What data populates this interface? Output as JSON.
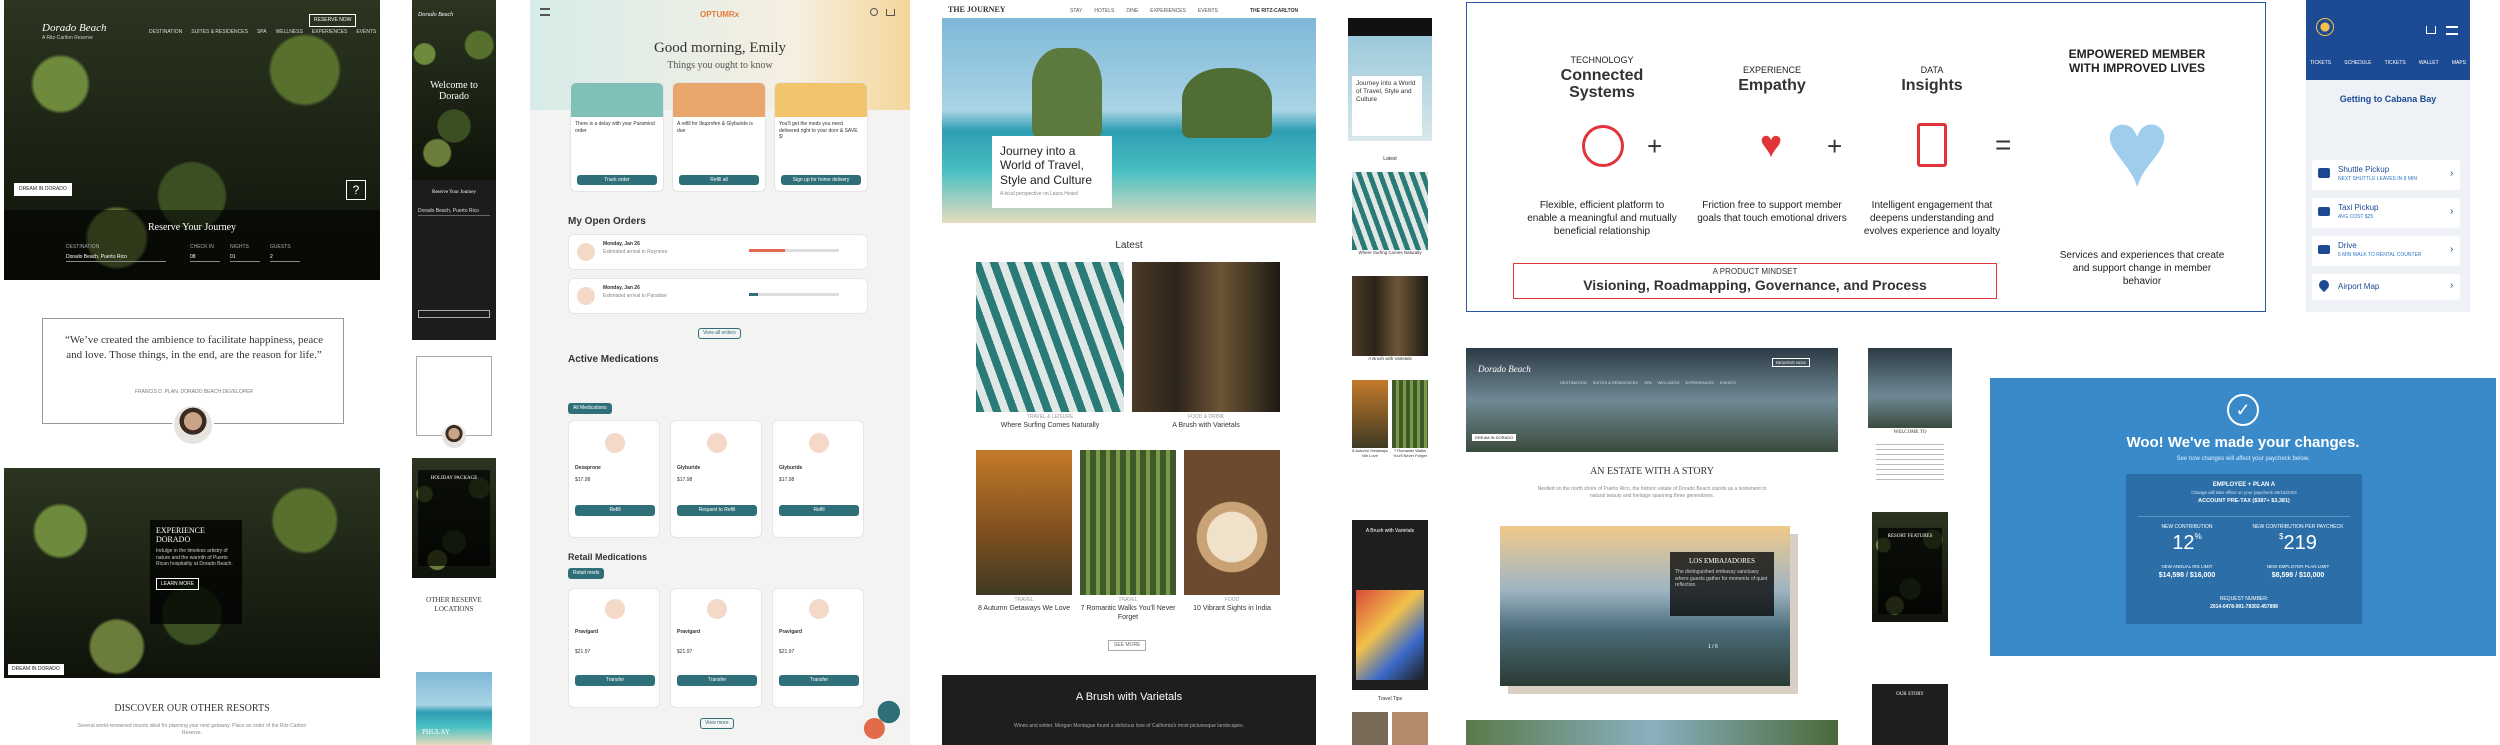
{
  "dorado": {
    "logo": "Dorado Beach",
    "logo_sub": "A Ritz-Carlton Reserve",
    "nav": [
      "DESTINATION",
      "SUITES & RESIDENCES",
      "SPA",
      "WELLNESS",
      "EXPERIENCES",
      "EVENTS"
    ],
    "top_button": "RESERVE NOW",
    "hero_badge": "DREAM IN DORADO",
    "reserve_title": "Reserve Your Journey",
    "destination_label": "DESTINATION",
    "destination_value": "Dorado Beach, Puerto Rico",
    "checkin_label": "CHECK IN",
    "checkin_value": "08",
    "checkout_label": "NIGHTS",
    "checkout_value": "01",
    "guests_label": "GUESTS",
    "guests_value": "2",
    "quote": "“We’ve created the ambience to facilitate happiness, peace and love. Those things, in the end, are the reason for life.”",
    "quote_author": "FRANCIS D. PLAN, DORADO BEACH DEVELOPER",
    "experience_title": "EXPERIENCE DORADO",
    "experience_text": "Indulge in the timeless artistry of nature and the warmth of Puerto Rican hospitality at Dorado Beach.",
    "experience_button": "LEARN MORE",
    "discover_title": "DISCOVER OUR OTHER RESORTS",
    "discover_text": "Several world-renowned resorts ideal for planning your next getaway. Place an order of the Ritz-Carlton Reserve."
  },
  "dorado_mobile": {
    "welcome": "Welcome to Dorado",
    "reserve_title": "Reserve Your Journey",
    "destination": "Dorado Beach, Puerto Rico",
    "holiday": "HOLIDAY PACKAGE",
    "other": "OTHER RESERVE LOCATIONS",
    "phulay": "PHULAY"
  },
  "health": {
    "brand": "OPTUMRx",
    "greeting": "Good morning, Emily",
    "subgreeting": "Things you ought to know",
    "tips": [
      {
        "title": "There is a delay with your Paramind order",
        "btn": "Track order"
      },
      {
        "title": "A refill for Ibuprofen & Glyburide is due",
        "btn": "Refill all"
      },
      {
        "title": "You'll get the meds you need delivered right to your door & SAVE $!",
        "btn": "Sign up for home delivery"
      }
    ],
    "orders_title": "My Open Orders",
    "orders": [
      {
        "date": "Monday, Jan 26",
        "desc": "Estimated arrival to Raymore"
      },
      {
        "date": "Monday, Jan 26",
        "desc": "Estimated arrival to Paradise"
      }
    ],
    "view_all": "View all orders",
    "active_title": "Active Medications",
    "filter_label": "All Medications",
    "meds": [
      {
        "name": "Dexaprone",
        "price": "$17.98",
        "action": "Refill"
      },
      {
        "name": "Glyburide",
        "price": "$17.98",
        "action": "Request to Refill"
      },
      {
        "name": "Glyburide",
        "price": "$17.98",
        "action": "Refill"
      }
    ],
    "retail_title": "Retail Medications",
    "retail_filter": "Retail meds",
    "retail": [
      {
        "name": "Pravigard",
        "price": "$21.97",
        "action": "Transfer"
      },
      {
        "name": "Pravigard",
        "price": "$21.97",
        "action": "Transfer"
      },
      {
        "name": "Pravigard",
        "price": "$21.97",
        "action": "Transfer"
      }
    ],
    "view_more": "View more"
  },
  "journey": {
    "logo": "THE JOURNEY",
    "nav": [
      "STAY",
      "HOTELS",
      "DINE",
      "EXPERIENCES",
      "EVENTS"
    ],
    "brand_right": "THE RITZ-CARLTON",
    "hero_title": "Journey into a World of Travel, Style and Culture",
    "hero_meta": "A local perspective on Laura Heard",
    "latest": "Latest",
    "articles": [
      {
        "cat": "TRAVEL & LEISURE",
        "title": "Where Surfing Comes Naturally"
      },
      {
        "cat": "FOOD & DRINK",
        "title": "A Brush with Varietals"
      },
      {
        "cat": "TRAVEL",
        "title": "8 Autumn Getaways We Love"
      },
      {
        "cat": "TRAVEL",
        "title": "7 Romantic Walks You'll Never Forget"
      },
      {
        "cat": "FOOD",
        "title": "10 Vibrant Sights in India"
      }
    ],
    "load_more": "SEE MORE",
    "feature_title": "A Brush with Varietals",
    "feature_text": "Wines and winter. Morgan Montague found a delicious love of California's most picturesque landscapes."
  },
  "journey_mobile": {
    "title": "Journey into a World of Travel, Style and Culture",
    "latest": "Latest",
    "items": [
      "Where Surfing Comes Naturally",
      "A Brush with Varietals",
      "8 Autumn Getaways We Love",
      "7 Romantic Walks You'll Never Forget"
    ],
    "feature": "A Brush with Varietals",
    "travel_tips": "Travel Tips"
  },
  "member": {
    "cols": [
      {
        "kicker": "TECHNOLOGY",
        "title": "Connected Systems",
        "text": "Flexible, efficient platform to enable a meaningful and mutually beneficial relationship"
      },
      {
        "kicker": "EXPERIENCE",
        "title": "Empathy",
        "text": "Friction free to support member goals that touch emotional drivers"
      },
      {
        "kicker": "DATA",
        "title": "Insights",
        "text": "Intelligent engagement that deepens understanding and evolves experience and loyalty"
      }
    ],
    "result_title": "EMPOWERED MEMBER WITH IMPROVED LIVES",
    "result_text": "Services and experiences that create and support change in member behavior",
    "plus": "+",
    "equals": "=",
    "mindset_kicker": "A PRODUCT MINDSET",
    "mindset": "Visioning, Roadmapping, Governance, and Process"
  },
  "cabana": {
    "tabs": [
      "TICKETS",
      "SCHEDULE",
      "TICKETS",
      "WALLET",
      "MAPS"
    ],
    "title": "Getting to Cabana Bay",
    "items": [
      {
        "title": "Shuttle Pickup",
        "sub": "NEXT SHUTTLE LEAVES IN 8 MIN"
      },
      {
        "title": "Taxi Pickup",
        "sub": "AVG COST $25"
      },
      {
        "title": "Drive",
        "sub": "5 MIN WALK TO RENTAL COUNTER"
      },
      {
        "title": "Airport Map",
        "sub": ""
      }
    ]
  },
  "estate": {
    "logo": "Dorado Beach",
    "nav": [
      "DESTINATION",
      "SUITES & RESIDENCES",
      "SPA",
      "WELLNESS",
      "EXPERIENCES",
      "EVENTS"
    ],
    "button": "RESERVE NOW",
    "badge": "DREAM IN DORADO",
    "title": "AN ESTATE WITH A STORY",
    "text": "Nestled on the north shore of Puerto Rico, the historic estate of Dorado Beach stands as a testament to natural beauty and heritage spanning three generations.",
    "caption": "LOS EMBAJADORES",
    "caption_text": "The distinguished embassy sanctuary where guests gather for moments of quiet reflection.",
    "pager": "1 / 6"
  },
  "estate_mobile": {
    "welcome": "WELCOME TO",
    "features": "RESORT FEATURES",
    "story": "OUR STORY"
  },
  "benefits": {
    "title": "Woo! We've made your changes.",
    "sub": "See how changes will affect your paycheck below.",
    "plan": "EMPLOYEE + PLAN A",
    "change_note": "Change will take effect on your paycheck 08/15/2024",
    "account": "ACCOUNT PRE-TAX ($387+ $3,381)",
    "left_label": "NEW CONTRIBUTION",
    "left_value": "12",
    "left_unit": "%",
    "right_label": "NEW CONTRIBUTION PER PAYCHECK",
    "right_value": "219",
    "right_unit": "$",
    "annual_label_l": "NEW ANNUAL IRS LIMIT",
    "annual_value_l": "$14,598 / $16,000",
    "annual_label_r": "NEW EMPLOYER PLAN LIMIT",
    "annual_value_r": "$8,598 / $10,000",
    "request_label": "REQUEST NUMBER:",
    "request_value": "2014-0478-991-78302-457898"
  }
}
